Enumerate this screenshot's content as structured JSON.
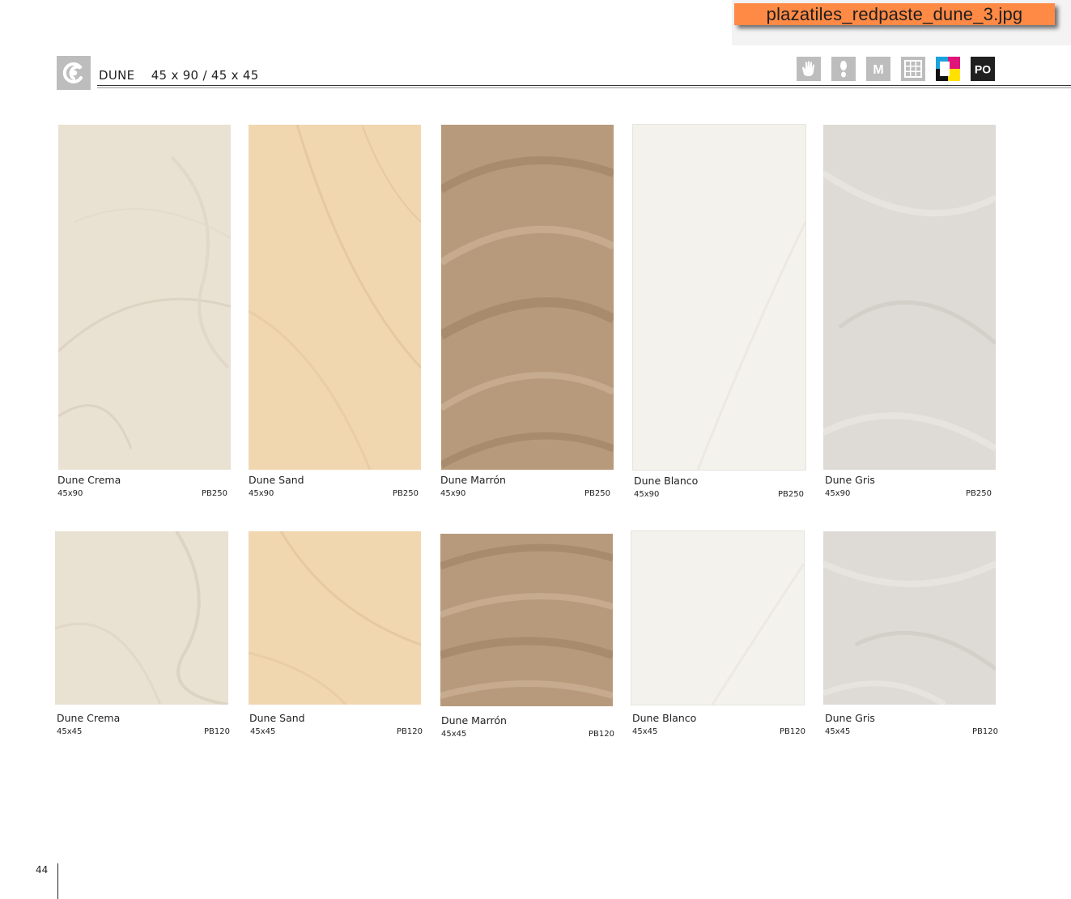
{
  "file_banner": {
    "text": "plazatiles_redpaste_dune_3.jpg"
  },
  "header": {
    "series": "DUNE",
    "formats": "45 x 90 / 45 x 45"
  },
  "feature_icons": [
    {
      "name": "hand-icon",
      "label": ""
    },
    {
      "name": "foot-icon",
      "label": ""
    },
    {
      "name": "m-badge-icon",
      "label": "M"
    },
    {
      "name": "grid-icon",
      "label": ""
    },
    {
      "name": "color-blocks-icon",
      "label": ""
    },
    {
      "name": "po-badge-icon",
      "label": "PO"
    }
  ],
  "colors": {
    "crema": "#e9e1d2",
    "sand": "#f0d7b0",
    "marron": "#b79a7c",
    "blanco": "#f4f2ec",
    "gris": "#dedbd6",
    "banner": "#ff8a45"
  },
  "rows": [
    {
      "tiles": [
        {
          "name": "Dune Crema",
          "size": "45x90",
          "code": "PB250",
          "color": "crema"
        },
        {
          "name": "Dune Sand",
          "size": "45x90",
          "code": "PB250",
          "color": "sand"
        },
        {
          "name": "Dune Marrón",
          "size": "45x90",
          "code": "PB250",
          "color": "marron"
        },
        {
          "name": "Dune Blanco",
          "size": "45x90",
          "code": "PB250",
          "color": "blanco"
        },
        {
          "name": "Dune Gris",
          "size": "45x90",
          "code": "PB250",
          "color": "gris"
        }
      ]
    },
    {
      "tiles": [
        {
          "name": "Dune Crema",
          "size": "45x45",
          "code": "PB120",
          "color": "crema"
        },
        {
          "name": "Dune Sand",
          "size": "45x45",
          "code": "PB120",
          "color": "sand"
        },
        {
          "name": "Dune Marrón",
          "size": "45x45",
          "code": "PB120",
          "color": "marron"
        },
        {
          "name": "Dune Blanco",
          "size": "45x45",
          "code": "PB120",
          "color": "blanco"
        },
        {
          "name": "Dune Gris",
          "size": "45x45",
          "code": "PB120",
          "color": "gris"
        }
      ]
    }
  ],
  "page_number": "44"
}
